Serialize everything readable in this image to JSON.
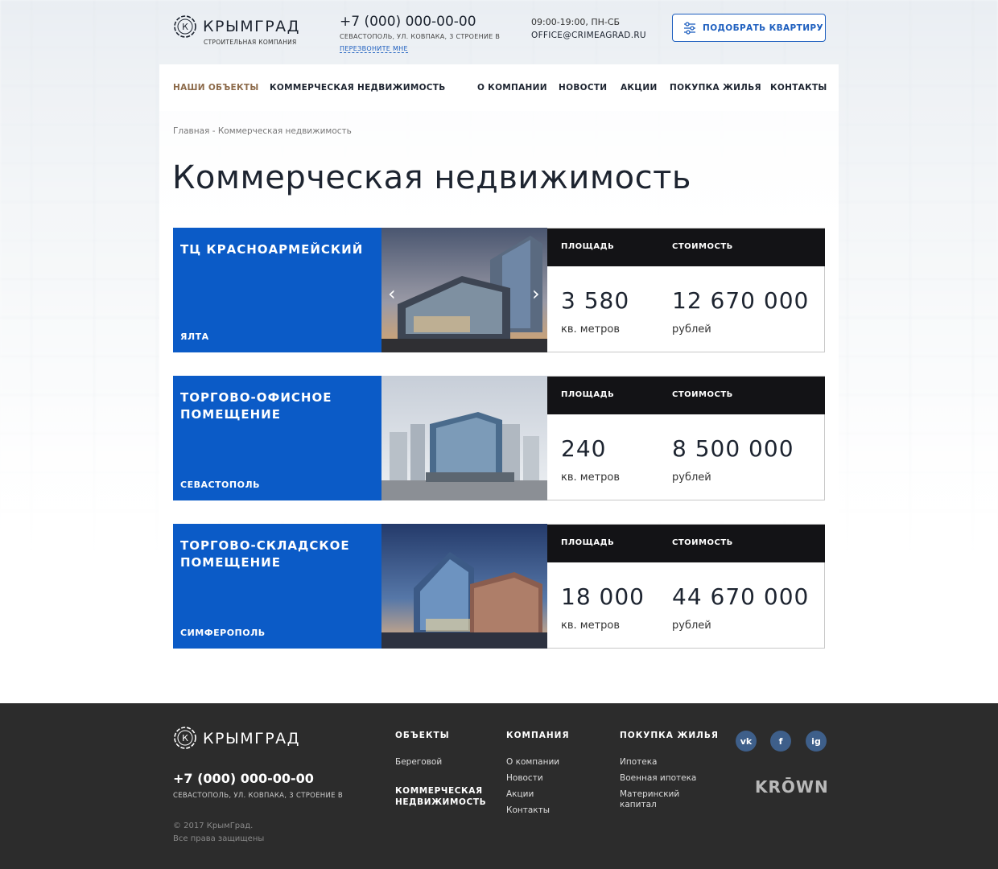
{
  "header": {
    "logo_text": "КРЫМГРАД",
    "logo_sub": "СТРОИТЕЛЬНАЯ КОМПАНИЯ",
    "phone": "+7 (000) 000-00-00",
    "address": "СЕВАСТОПОЛЬ, УЛ. КОВПАКА, 3 СТРОЕНИЕ В",
    "callback": "ПЕРЕЗВОНИТЕ МНЕ",
    "hours": "09:00-19:00, ПН-СБ",
    "email": "OFFICE@CRIMEAGRAD.RU",
    "pick_button": "ПОДОБРАТЬ КВАРТИРУ"
  },
  "nav": {
    "items": [
      {
        "label": "НАШИ ОБЪЕКТЫ",
        "active": true
      },
      {
        "label": "КОММЕРЧЕСКАЯ НЕДВИЖИМОСТЬ"
      },
      {
        "label": "О КОМПАНИИ"
      },
      {
        "label": "НОВОСТИ"
      },
      {
        "label": "АКЦИИ"
      },
      {
        "label": "ПОКУПКА ЖИЛЬЯ"
      },
      {
        "label": "КОНТАКТЫ"
      }
    ]
  },
  "breadcrumb": "Главная - Коммерческая недвижимость",
  "page_title": "Коммерческая недвижимость",
  "cards": [
    {
      "name": "ТЦ КРАСНОАРМЕЙСКИЙ",
      "city": "ЯЛТА",
      "area_label": "ПЛОЩАДЬ",
      "price_label": "СТОИМОСТЬ",
      "area": "3 580",
      "area_unit": "кв. метров",
      "price": "12 670 000",
      "price_unit": "рублей"
    },
    {
      "name": "ТОРГОВО-ОФИСНОЕ ПОМЕЩЕНИЕ",
      "city": "СЕВАСТОПОЛЬ",
      "area_label": "ПЛОЩАДЬ",
      "price_label": "СТОИМОСТЬ",
      "area": "240",
      "area_unit": "кв. метров",
      "price": "8 500 000",
      "price_unit": "рублей"
    },
    {
      "name": "ТОРГОВО-СКЛАДСКОЕ ПОМЕЩЕНИЕ",
      "city": "СИМФЕРОПОЛЬ",
      "area_label": "ПЛОЩАДЬ",
      "price_label": "СТОИМОСТЬ",
      "area": "18 000",
      "area_unit": "кв. метров",
      "price": "44 670 000",
      "price_unit": "рублей"
    }
  ],
  "footer": {
    "logo_text": "КРЫМГРАД",
    "phone": "+7 (000) 000-00-00",
    "address": "СЕВАСТОПОЛЬ, УЛ. КОВПАКА, 3 СТРОЕНИЕ В",
    "copyright": "© 2017 КрымГрад.",
    "rights": "Все права защищены",
    "col_objects": {
      "title": "ОБЪЕКТЫ",
      "link1": "Береговой",
      "link2": "КОММЕРЧЕСКАЯ НЕДВИЖИМОСТЬ"
    },
    "col_company": {
      "title": "КОМПАНИЯ",
      "links": [
        "О компании",
        "Новости",
        "Акции",
        "Контакты"
      ]
    },
    "col_buy": {
      "title": "ПОКУПКА ЖИЛЬЯ",
      "links": [
        "Ипотека",
        "Военная ипотека",
        "Материнский капитал"
      ]
    },
    "social": {
      "vk": "vk",
      "fb": "f",
      "ig": "ig"
    },
    "krown": "KRŌWN"
  },
  "colors": {
    "accent_blue": "#0b5bc7",
    "nav_active": "#8c6a4a",
    "stats_head": "#131316",
    "footer_bg": "#2c2c2c"
  }
}
